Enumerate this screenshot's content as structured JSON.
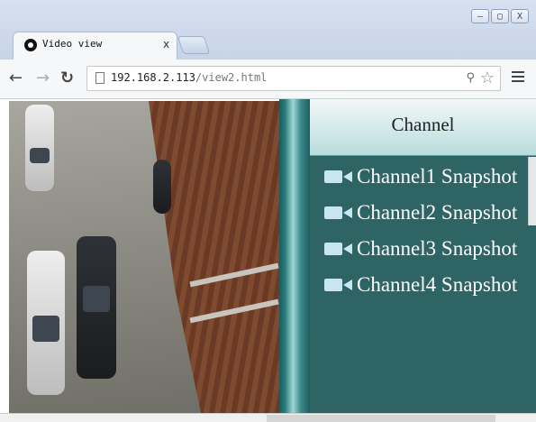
{
  "browser": {
    "tab_title": "Video view",
    "tab_close": "x",
    "url_host": "192.168.2.113",
    "url_path": "/view2.html",
    "window_controls": [
      "–",
      "▢",
      "X"
    ]
  },
  "panel": {
    "title": "Channel",
    "items": [
      {
        "label": "Channel1 Snapshot",
        "icon": "camera-icon"
      },
      {
        "label": "Channel2 Snapshot",
        "icon": "camera-icon"
      },
      {
        "label": "Channel3 Snapshot",
        "icon": "camera-icon"
      },
      {
        "label": "Channel4 Snapshot",
        "icon": "camera-icon"
      }
    ]
  },
  "colors": {
    "panel_bg": "#2f6465",
    "panel_header": "#c9e3e3",
    "divider": "#2e7d7d",
    "item_text": "#ffffff"
  }
}
